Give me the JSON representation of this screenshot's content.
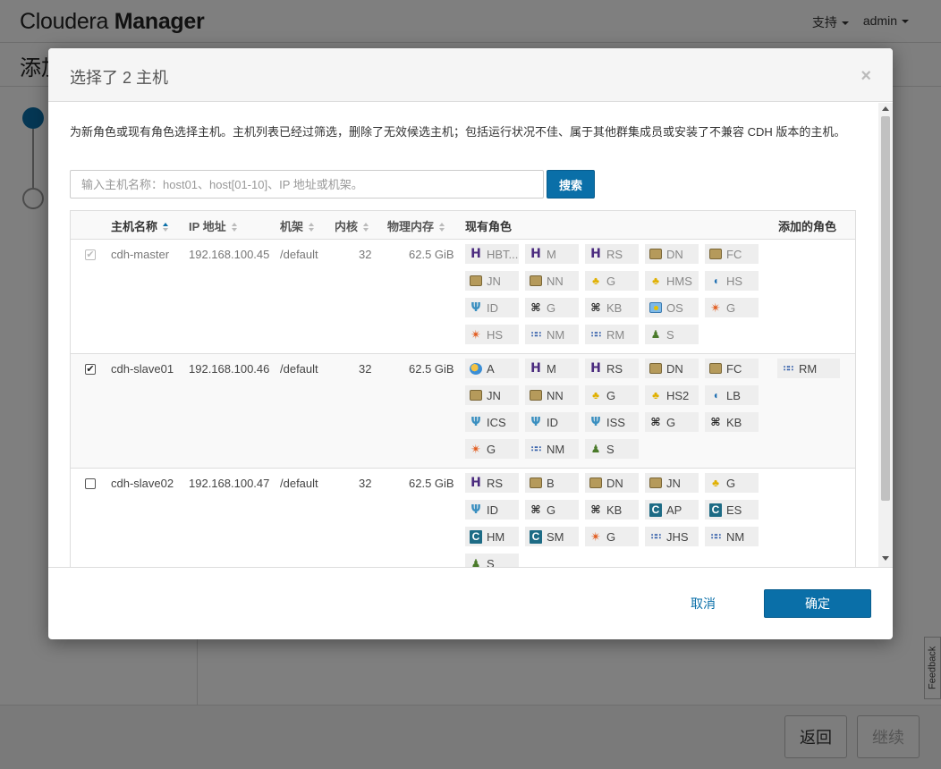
{
  "app": {
    "brand_light": "Cloudera",
    "brand_bold": "Manager",
    "menu_support": "支持",
    "menu_user": "admin",
    "page_title": "添加",
    "back_label": "返回",
    "continue_label": "继续",
    "feedback_label": "Feedback"
  },
  "modal": {
    "title": "选择了 2 主机",
    "close_glyph": "×",
    "description": "为新角色或现有角色选择主机。主机列表已经过筛选，删除了无效候选主机；包括运行状况不佳、属于其他群集成员或安装了不兼容 CDH 版本的主机。",
    "search": {
      "placeholder": "输入主机名称：host01、host[01-10]、IP 地址或机架。",
      "value": "",
      "button_label": "搜索"
    },
    "table": {
      "headers": {
        "hostname": "主机名称",
        "ip": "IP 地址",
        "rack": "机架",
        "cores": "内核",
        "memory": "物理内存",
        "existing_roles": "现有角色",
        "added_roles": "添加的角色"
      },
      "rows": [
        {
          "checked": true,
          "disabled": true,
          "hostname": "cdh-master",
          "ip": "192.168.100.45",
          "rack": "/default",
          "cores": "32",
          "memory": "62.5 GiB",
          "roles": [
            {
              "icon": "hbase-icon",
              "label": "HBT..."
            },
            {
              "icon": "hbase-icon",
              "label": "M"
            },
            {
              "icon": "hbase-icon",
              "label": "RS"
            },
            {
              "icon": "hdfs-icon",
              "label": "DN"
            },
            {
              "icon": "hdfs-icon",
              "label": "FC"
            },
            {
              "icon": "hdfs-icon",
              "label": "JN"
            },
            {
              "icon": "hdfs-icon",
              "label": "NN"
            },
            {
              "icon": "hive-icon",
              "label": "G"
            },
            {
              "icon": "hive-icon",
              "label": "HMS"
            },
            {
              "icon": "hue-icon",
              "label": "HS"
            },
            {
              "icon": "impala-icon",
              "label": "ID"
            },
            {
              "icon": "zookeeper-icon",
              "label": "G"
            },
            {
              "icon": "zookeeper-icon",
              "label": "KB"
            },
            {
              "icon": "oozie-icon",
              "label": "OS"
            },
            {
              "icon": "spark-icon",
              "label": "G"
            },
            {
              "icon": "spark-icon",
              "label": "HS"
            },
            {
              "icon": "yarn-icon",
              "label": "NM"
            },
            {
              "icon": "yarn-icon",
              "label": "RM"
            },
            {
              "icon": "sqoop-icon",
              "label": "S"
            }
          ],
          "added_roles": []
        },
        {
          "checked": true,
          "disabled": false,
          "hostname": "cdh-slave01",
          "ip": "192.168.100.46",
          "rack": "/default",
          "cores": "32",
          "memory": "62.5 GiB",
          "roles": [
            {
              "icon": "airflow-icon",
              "label": "A"
            },
            {
              "icon": "hbase-icon",
              "label": "M"
            },
            {
              "icon": "hbase-icon",
              "label": "RS"
            },
            {
              "icon": "hdfs-icon",
              "label": "DN"
            },
            {
              "icon": "hdfs-icon",
              "label": "FC"
            },
            {
              "icon": "hdfs-icon",
              "label": "JN"
            },
            {
              "icon": "hdfs-icon",
              "label": "NN"
            },
            {
              "icon": "hive-icon",
              "label": "G"
            },
            {
              "icon": "hive-icon",
              "label": "HS2"
            },
            {
              "icon": "hue-icon",
              "label": "LB"
            },
            {
              "icon": "impala-icon",
              "label": "ICS"
            },
            {
              "icon": "impala-icon",
              "label": "ID"
            },
            {
              "icon": "impala-icon",
              "label": "ISS"
            },
            {
              "icon": "zookeeper-icon",
              "label": "G"
            },
            {
              "icon": "zookeeper-icon",
              "label": "KB"
            },
            {
              "icon": "spark-icon",
              "label": "G"
            },
            {
              "icon": "yarn-icon",
              "label": "NM"
            },
            {
              "icon": "sqoop-icon",
              "label": "S"
            }
          ],
          "added_roles": [
            {
              "icon": "yarn-icon",
              "label": "RM"
            }
          ]
        },
        {
          "checked": false,
          "disabled": false,
          "hostname": "cdh-slave02",
          "ip": "192.168.100.47",
          "rack": "/default",
          "cores": "32",
          "memory": "62.5 GiB",
          "roles": [
            {
              "icon": "hbase-icon",
              "label": "RS"
            },
            {
              "icon": "hdfs-icon",
              "label": "B"
            },
            {
              "icon": "hdfs-icon",
              "label": "DN"
            },
            {
              "icon": "hdfs-icon",
              "label": "JN"
            },
            {
              "icon": "hive-icon",
              "label": "G"
            },
            {
              "icon": "impala-icon",
              "label": "ID"
            },
            {
              "icon": "zookeeper-icon",
              "label": "G"
            },
            {
              "icon": "zookeeper-icon",
              "label": "KB"
            },
            {
              "icon": "cloudera-icon",
              "label": "AP"
            },
            {
              "icon": "cloudera-icon",
              "label": "ES"
            },
            {
              "icon": "cloudera-icon",
              "label": "HM"
            },
            {
              "icon": "cloudera-icon",
              "label": "SM"
            },
            {
              "icon": "spark-icon",
              "label": "G"
            },
            {
              "icon": "yarn-icon",
              "label": "JHS"
            },
            {
              "icon": "yarn-icon",
              "label": "NM"
            },
            {
              "icon": "sqoop-icon",
              "label": "S"
            }
          ],
          "added_roles": []
        }
      ]
    },
    "cancel_label": "取消",
    "confirm_label": "确定"
  },
  "colors": {
    "primary": "#0a6fa8",
    "backdrop": "rgba(0,0,0,0.5)"
  }
}
